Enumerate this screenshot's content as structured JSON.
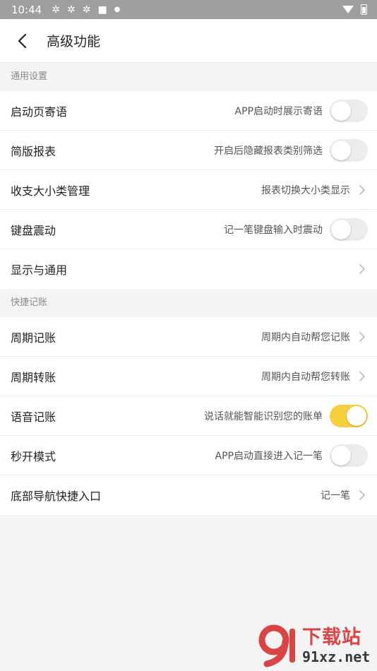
{
  "status_bar": {
    "time": "10:44"
  },
  "header": {
    "title": "高级功能"
  },
  "sections": [
    {
      "title": "通用设置",
      "rows": [
        {
          "label": "启动页寄语",
          "desc": "APP启动时展示寄语",
          "control": "toggle",
          "on": false
        },
        {
          "label": "简版报表",
          "desc": "开启后隐藏报表类别筛选",
          "control": "toggle",
          "on": false
        },
        {
          "label": "收支大小类管理",
          "desc": "报表切换大小类显示",
          "control": "chevron"
        },
        {
          "label": "键盘震动",
          "desc": "记一笔键盘输入时震动",
          "control": "toggle",
          "on": false
        },
        {
          "label": "显示与通用",
          "desc": "",
          "control": "chevron"
        }
      ]
    },
    {
      "title": "快捷记账",
      "rows": [
        {
          "label": "周期记账",
          "desc": "周期内自动帮您记账",
          "control": "chevron"
        },
        {
          "label": "周期转账",
          "desc": "周期内自动帮您转账",
          "control": "chevron"
        },
        {
          "label": "语音记账",
          "desc": "说话就能智能识别您的账单",
          "control": "toggle",
          "on": true
        },
        {
          "label": "秒开模式",
          "desc": "APP启动直接进入记一笔",
          "control": "toggle",
          "on": false
        },
        {
          "label": "底部导航快捷入口",
          "desc": "记一笔",
          "control": "chevron"
        }
      ]
    }
  ],
  "colors": {
    "toggle_on": "#f7cf3d",
    "toggle_off": "#ececec",
    "status_bar": "#9e9e9e"
  },
  "watermark": {
    "cn": "下载站",
    "en": "91xz.net"
  }
}
